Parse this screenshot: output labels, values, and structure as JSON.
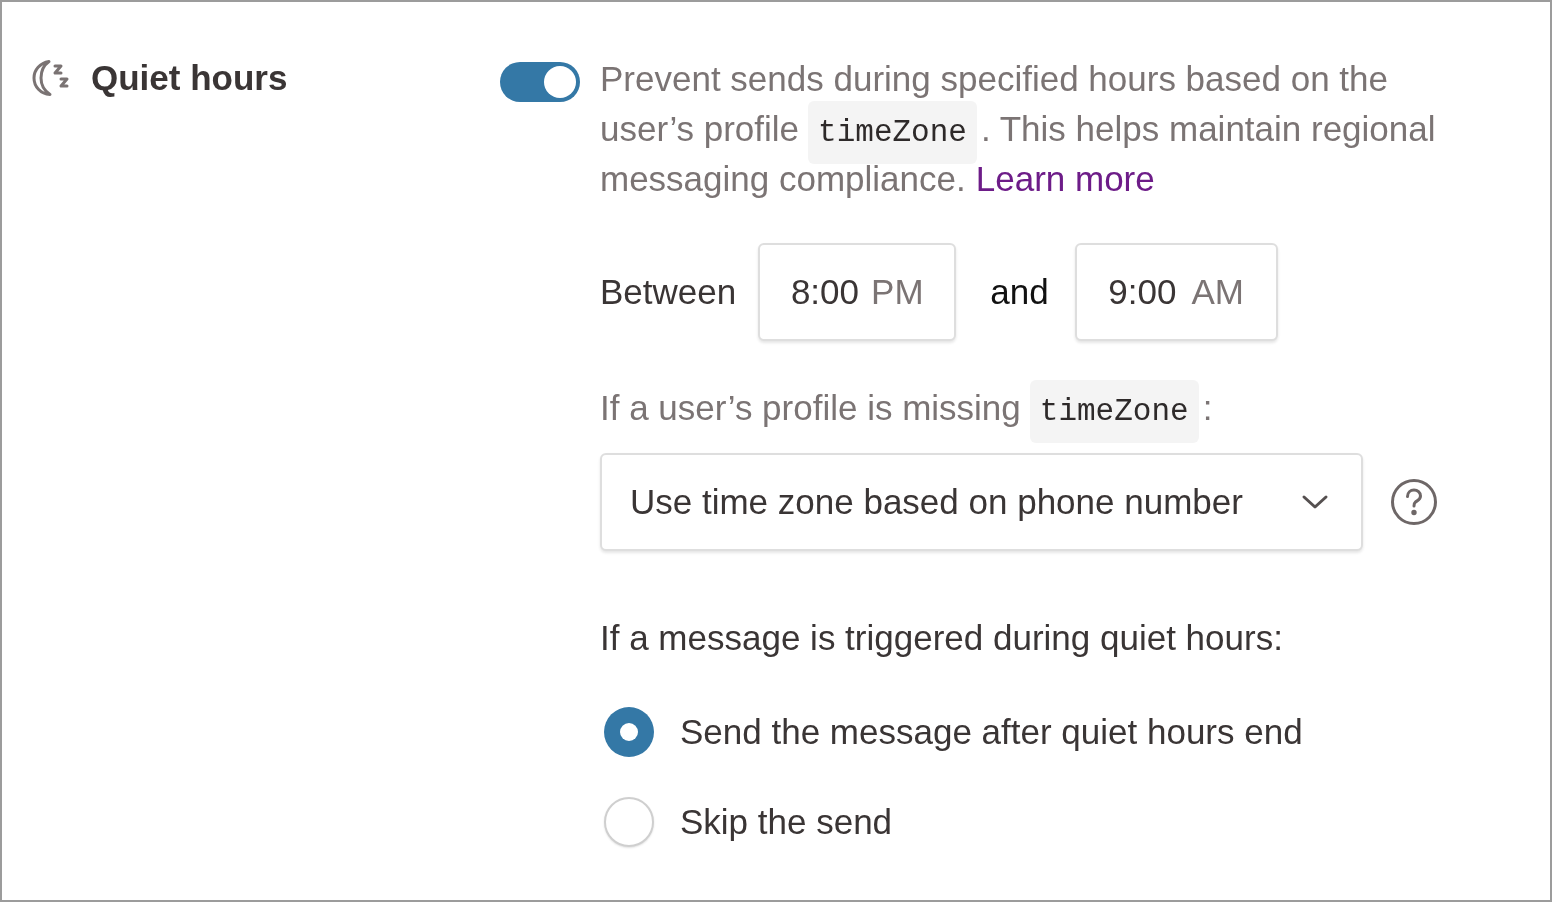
{
  "setting": {
    "title": "Quiet hours",
    "toggle": {
      "on": true
    },
    "description": [
      {
        "kind": "text",
        "text": "Prevent sends during specified hours based on the user’s profile"
      },
      {
        "kind": "code",
        "text": "timeZone"
      },
      {
        "kind": "text",
        "text": ". This helps maintain regional messaging compliance."
      },
      {
        "kind": "link",
        "text": "Learn more"
      }
    ]
  },
  "time_range": {
    "label": "Between",
    "start": {
      "time": "8:00",
      "period": "PM"
    },
    "joiner": "and",
    "end": {
      "time": "9:00",
      "period": "AM"
    }
  },
  "fallback": {
    "label": [
      {
        "kind": "text",
        "text": "If a user’s profile is missing"
      },
      {
        "kind": "code",
        "text": "timeZone"
      },
      {
        "kind": "text",
        "text": ":"
      }
    ],
    "select": {
      "value": "Use time zone based on phone number"
    }
  },
  "trigger": {
    "prompt": "If a message is triggered during quiet hours:",
    "options": [
      {
        "label": "Send the message after quiet hours end",
        "selected": true
      },
      {
        "label": "Skip the send",
        "selected": false
      }
    ]
  }
}
